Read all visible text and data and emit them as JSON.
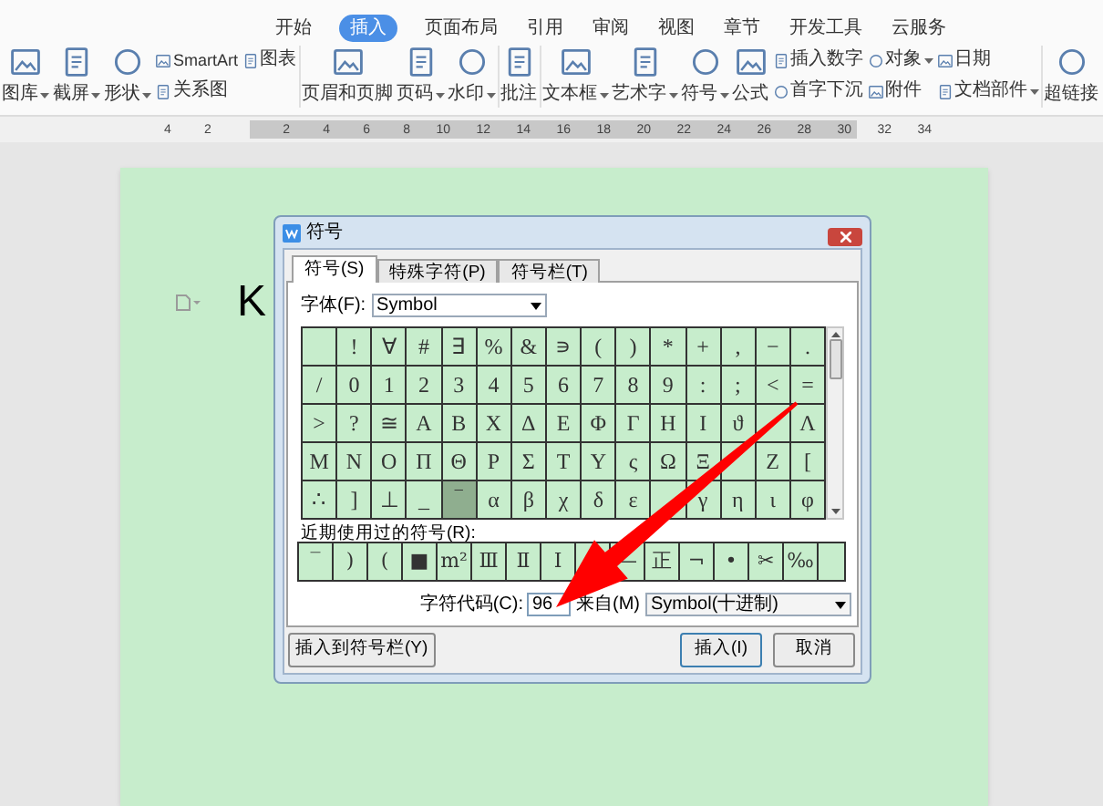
{
  "ribbon": {
    "tabs": [
      {
        "label": "开始",
        "selected": false
      },
      {
        "label": "插入",
        "selected": true
      },
      {
        "label": "页面布局",
        "selected": false
      },
      {
        "label": "引用",
        "selected": false
      },
      {
        "label": "审阅",
        "selected": false
      },
      {
        "label": "视图",
        "selected": false
      },
      {
        "label": "章节",
        "selected": false
      },
      {
        "label": "开发工具",
        "selected": false
      },
      {
        "label": "云服务",
        "selected": false
      }
    ],
    "tools": [
      {
        "kind": "large",
        "label": "图库",
        "dropdown": true
      },
      {
        "kind": "large",
        "label": "截屏",
        "dropdown": true
      },
      {
        "kind": "large",
        "label": "形状",
        "dropdown": true
      },
      {
        "kind": "stack",
        "items": [
          {
            "label": "SmartArt",
            "dropdown": false
          },
          {
            "label": "关系图",
            "dropdown": false
          }
        ]
      },
      {
        "kind": "stack",
        "items": [
          {
            "label": "图表",
            "dropdown": false
          }
        ]
      },
      {
        "kind": "divider"
      },
      {
        "kind": "large",
        "label": "页眉和页脚",
        "dropdown": false
      },
      {
        "kind": "large",
        "label": "页码",
        "dropdown": true
      },
      {
        "kind": "large",
        "label": "水印",
        "dropdown": true
      },
      {
        "kind": "divider"
      },
      {
        "kind": "large",
        "label": "批注",
        "dropdown": false
      },
      {
        "kind": "divider"
      },
      {
        "kind": "large",
        "label": "文本框",
        "dropdown": true
      },
      {
        "kind": "large",
        "label": "艺术字",
        "dropdown": true
      },
      {
        "kind": "large",
        "label": "符号",
        "dropdown": true
      },
      {
        "kind": "large",
        "label": "公式",
        "dropdown": false
      },
      {
        "kind": "stack",
        "items": [
          {
            "label": "插入数字",
            "dropdown": false
          },
          {
            "label": "首字下沉",
            "dropdown": false
          }
        ]
      },
      {
        "kind": "stack",
        "items": [
          {
            "label": "对象",
            "dropdown": true
          },
          {
            "label": "附件",
            "dropdown": false
          }
        ]
      },
      {
        "kind": "stack",
        "items": [
          {
            "label": "日期",
            "dropdown": false
          },
          {
            "label": "文档部件",
            "dropdown": true
          }
        ]
      },
      {
        "kind": "divider"
      },
      {
        "kind": "large",
        "label": "超链接",
        "dropdown": false
      }
    ]
  },
  "ruler": {
    "left_labels": [
      "4",
      "2"
    ],
    "labels": [
      "2",
      "4",
      "6",
      "8",
      "10",
      "12",
      "14",
      "16",
      "18",
      "20",
      "22",
      "24",
      "26",
      "28",
      "30",
      "32",
      "34"
    ]
  },
  "document": {
    "text": "K"
  },
  "dialog": {
    "title": "符号",
    "tabs": [
      {
        "label": "符号(S)",
        "selected": true
      },
      {
        "label": "特殊字符(P)",
        "selected": false
      },
      {
        "label": "符号栏(T)",
        "selected": false
      }
    ],
    "font_label": "字体(F):",
    "font_value": "Symbol",
    "symbols": [
      [
        {
          "selected": false
        },
        {
          "char": "!",
          "selected": false
        },
        {
          "char": "∀",
          "selected": false
        },
        {
          "char": "#",
          "selected": false
        },
        {
          "char": "∃",
          "selected": false
        },
        {
          "char": "%",
          "selected": false
        },
        {
          "char": "&",
          "selected": false
        },
        {
          "char": "∍",
          "selected": false
        },
        {
          "char": "(",
          "selected": false
        },
        {
          "char": ")",
          "selected": false
        },
        {
          "char": "*",
          "selected": false
        },
        {
          "char": "+",
          "selected": false
        },
        {
          "char": ",",
          "selected": false
        },
        {
          "char": "−",
          "selected": false
        },
        {
          "char": ".",
          "selected": false
        }
      ],
      [
        {
          "char": "/",
          "selected": false
        },
        {
          "char": "0",
          "selected": false
        },
        {
          "char": "1",
          "selected": false
        },
        {
          "char": "2",
          "selected": false
        },
        {
          "char": "3",
          "selected": false
        },
        {
          "char": "4",
          "selected": false
        },
        {
          "char": "5",
          "selected": false
        },
        {
          "char": "6",
          "selected": false
        },
        {
          "char": "7",
          "selected": false
        },
        {
          "char": "8",
          "selected": false
        },
        {
          "char": "9",
          "selected": false
        },
        {
          "char": ":",
          "selected": false
        },
        {
          "char": ";",
          "selected": false
        },
        {
          "char": "<",
          "selected": false
        },
        {
          "char": "=",
          "selected": false
        }
      ],
      [
        {
          "char": ">",
          "selected": false
        },
        {
          "char": "?",
          "selected": false
        },
        {
          "char": "≅",
          "selected": false
        },
        {
          "char": "Α",
          "selected": false
        },
        {
          "char": "Β",
          "selected": false
        },
        {
          "char": "Χ",
          "selected": false
        },
        {
          "char": "Δ",
          "selected": false
        },
        {
          "char": "Ε",
          "selected": false
        },
        {
          "char": "Φ",
          "selected": false
        },
        {
          "char": "Γ",
          "selected": false
        },
        {
          "char": "Η",
          "selected": false
        },
        {
          "char": "Ι",
          "selected": false
        },
        {
          "char": "ϑ",
          "selected": false
        },
        {
          "selected": false
        },
        {
          "char": "Λ",
          "selected": false
        }
      ],
      [
        {
          "char": "Μ",
          "selected": false
        },
        {
          "char": "Ν",
          "selected": false
        },
        {
          "char": "Ο",
          "selected": false
        },
        {
          "char": "Π",
          "selected": false
        },
        {
          "char": "Θ",
          "selected": false
        },
        {
          "char": "Ρ",
          "selected": false
        },
        {
          "char": "Σ",
          "selected": false
        },
        {
          "char": "Τ",
          "selected": false
        },
        {
          "char": "Υ",
          "selected": false
        },
        {
          "char": "ς",
          "selected": false
        },
        {
          "char": "Ω",
          "selected": false
        },
        {
          "char": "Ξ",
          "selected": false
        },
        {
          "selected": false
        },
        {
          "char": "Ζ",
          "selected": false
        },
        {
          "char": "[",
          "selected": false
        }
      ],
      [
        {
          "char": "∴",
          "selected": false
        },
        {
          "char": "]",
          "selected": false
        },
        {
          "char": "⊥",
          "selected": false
        },
        {
          "char": "_",
          "selected": false
        },
        {
          "char": "‾",
          "selected": true
        },
        {
          "char": "α",
          "selected": false
        },
        {
          "char": "β",
          "selected": false
        },
        {
          "char": "χ",
          "selected": false
        },
        {
          "char": "δ",
          "selected": false
        },
        {
          "char": "ε",
          "selected": false
        },
        {
          "selected": false
        },
        {
          "char": "γ",
          "selected": false
        },
        {
          "char": "η",
          "selected": false
        },
        {
          "char": "ι",
          "selected": false
        },
        {
          "char": "φ",
          "selected": false
        }
      ]
    ],
    "recent_label": "近期使用过的符号(R):",
    "recent": [
      {
        "kind": "symbol",
        "char": "‾"
      },
      {
        "kind": "symbol",
        "char": ")"
      },
      {
        "kind": "symbol",
        "char": "("
      },
      {
        "kind": "symbol",
        "char": "■"
      },
      {
        "kind": "symbol",
        "char": "m²"
      },
      {
        "kind": "symbol",
        "char": "Ⅲ"
      },
      {
        "kind": "symbol",
        "char": "Ⅱ"
      },
      {
        "kind": "symbol",
        "char": "Ⅰ"
      },
      {
        "kind": "blank"
      },
      {
        "kind": "symbol",
        "char": "—"
      },
      {
        "kind": "symbol",
        "char": "正"
      },
      {
        "kind": "symbol",
        "char": "¬"
      },
      {
        "kind": "symbol",
        "char": "•"
      },
      {
        "kind": "symbol",
        "char": "✂"
      },
      {
        "kind": "symbol",
        "char": "‰"
      }
    ],
    "code_label": "字符代码(C):",
    "code_value": "96",
    "from_label": "来自(M)",
    "from_value": "Symbol(十进制)",
    "buttons": [
      {
        "label": "插入到符号栏(Y)",
        "default": false
      },
      {
        "label": "插入(I)",
        "default": true
      },
      {
        "label": "取消",
        "default": false
      }
    ]
  }
}
